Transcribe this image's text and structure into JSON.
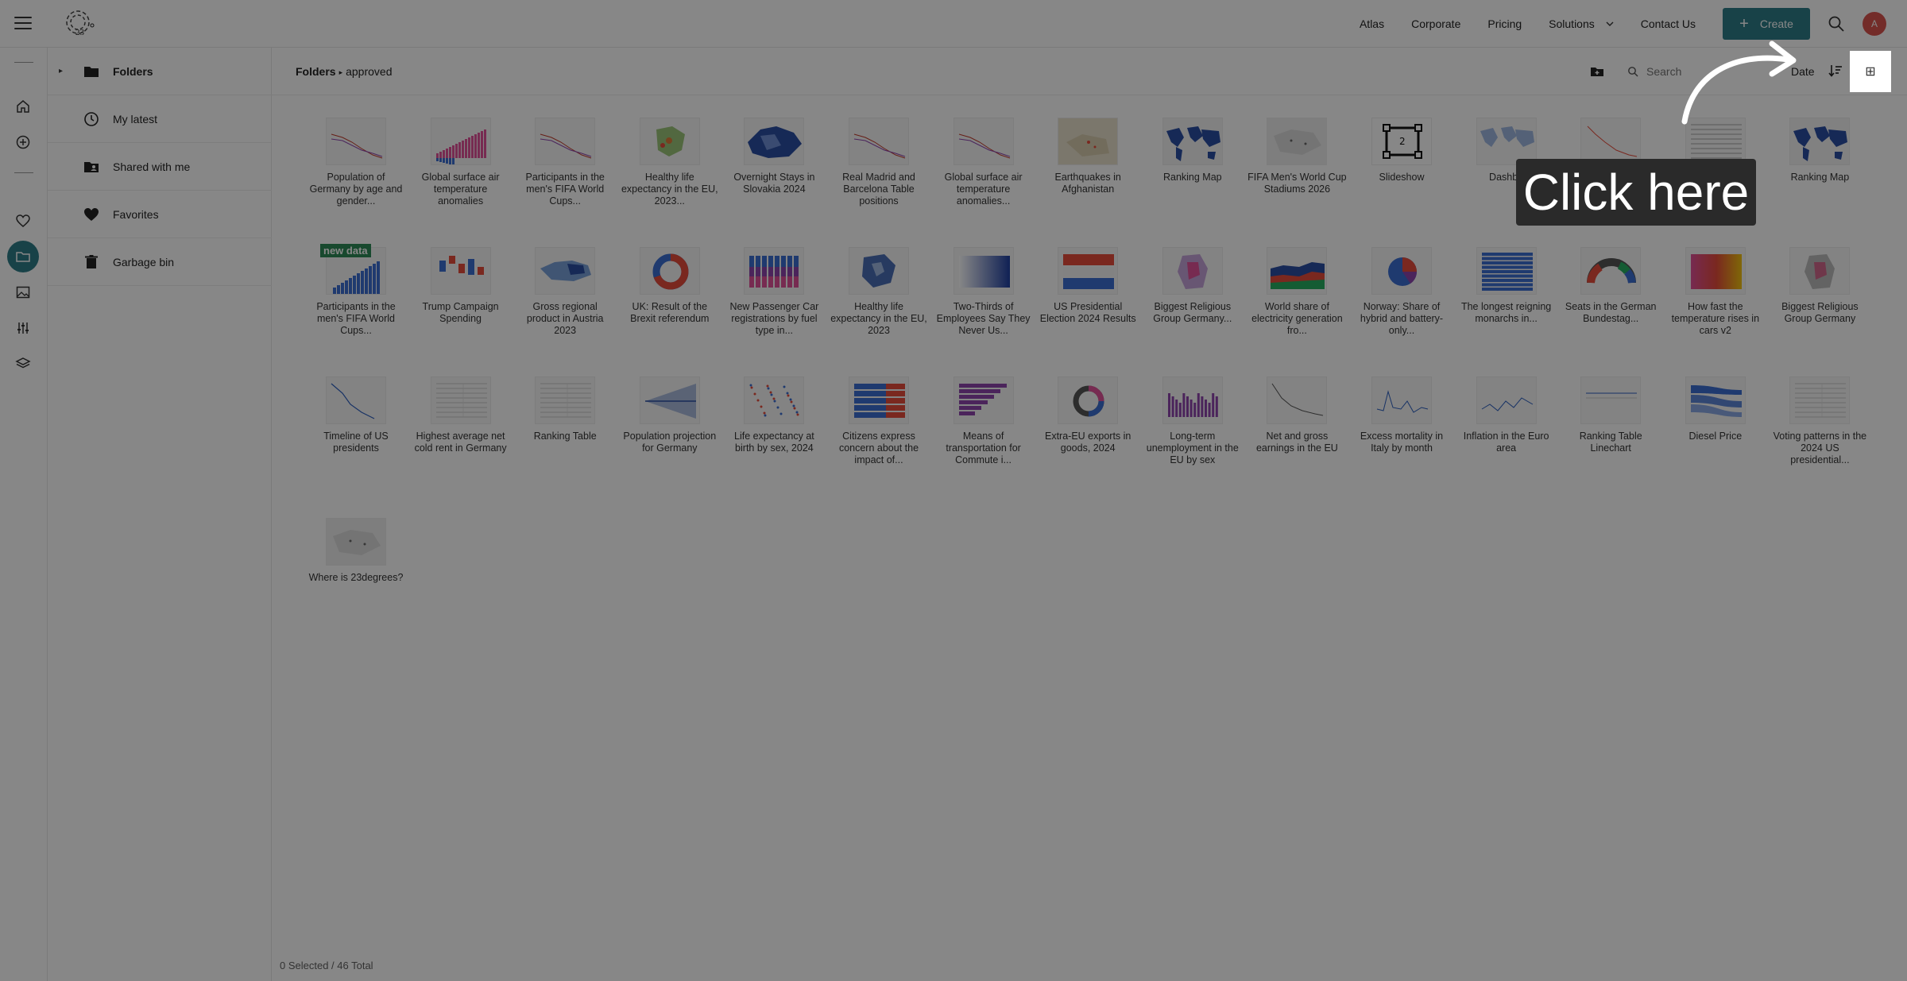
{
  "topnav": {
    "links": [
      "Atlas",
      "Corporate",
      "Pricing",
      "Solutions",
      "Contact Us"
    ],
    "create_label": "Create",
    "avatar_initial": "A",
    "accent_color": "#2e7d88"
  },
  "rail": {
    "icons": [
      "home-icon",
      "add-circle-icon",
      "heart-icon",
      "folder-icon",
      "image-icon",
      "sliders-icon",
      "layers-icon"
    ],
    "active": "folder-icon"
  },
  "panel": {
    "items": [
      {
        "label": "Folders",
        "icon": "folder-icon"
      },
      {
        "label": "My latest",
        "icon": "clock-icon"
      },
      {
        "label": "Shared with me",
        "icon": "shared-folder-icon"
      },
      {
        "label": "Favorites",
        "icon": "heart-icon"
      },
      {
        "label": "Garbage bin",
        "icon": "trash-icon"
      }
    ]
  },
  "content": {
    "breadcrumb_root": "Folders",
    "breadcrumb_sep": "▸",
    "breadcrumb_current": "approved",
    "search_placeholder": "Search",
    "sort_label": "Date",
    "grid_icon": "⊞"
  },
  "tiles": [
    {
      "label": "Population of Germany by age and gender...",
      "kind": "line"
    },
    {
      "label": "Global surface air temperature anomalies",
      "kind": "bars-warm"
    },
    {
      "label": "Participants in the men's FIFA World Cups...",
      "kind": "line"
    },
    {
      "label": "Healthy life expectancy in the EU, 2023...",
      "kind": "map-eu"
    },
    {
      "label": "Overnight Stays in Slovakia 2024",
      "kind": "map-blue"
    },
    {
      "label": "Real Madrid and Barcelona Table positions",
      "kind": "line"
    },
    {
      "label": "Global surface air temperature anomalies...",
      "kind": "line"
    },
    {
      "label": "Earthquakes in Afghanistan",
      "kind": "map-beige"
    },
    {
      "label": "Ranking Map",
      "kind": "world-blue"
    },
    {
      "label": "FIFA Men's World Cup Stadiums 2026",
      "kind": "map-plain"
    },
    {
      "label": "Slideshow",
      "kind": "slideshow"
    },
    {
      "label": "Dashbo",
      "kind": "world-light"
    },
    {
      "label": "",
      "kind": "line-red"
    },
    {
      "label": "",
      "kind": "table"
    },
    {
      "label": "Ranking Map",
      "kind": "world-blue"
    },
    {
      "label": "Participants in the men's FIFA World Cups...",
      "kind": "bars-blue",
      "badge": "new data"
    },
    {
      "label": "Trump Campaign Spending",
      "kind": "waterfall"
    },
    {
      "label": "Gross regional product in Austria 2023",
      "kind": "map-blue-light"
    },
    {
      "label": "UK: Result of the Brexit referendum",
      "kind": "donut-red"
    },
    {
      "label": "New Passenger Car registrations by fuel type in...",
      "kind": "stacked-bars"
    },
    {
      "label": "Healthy life expectancy in the EU, 2023",
      "kind": "map-eu-blue"
    },
    {
      "label": "Two-Thirds of Employees Say They Never Us...",
      "kind": "gradient-blue"
    },
    {
      "label": "US Presidential Election 2024 Results",
      "kind": "flag-bars"
    },
    {
      "label": "Biggest Religious Group Germany...",
      "kind": "map-purple"
    },
    {
      "label": "World share of electricity generation fro...",
      "kind": "area"
    },
    {
      "label": "Norway: Share of hybrid and battery-only...",
      "kind": "pie"
    },
    {
      "label": "The longest reigning monarchs in...",
      "kind": "hbars-blue"
    },
    {
      "label": "Seats in the German Bundestag...",
      "kind": "parliament"
    },
    {
      "label": "How fast the temperature rises in cars v2",
      "kind": "heatmap"
    },
    {
      "label": "Biggest Religious Group Germany",
      "kind": "map-grey"
    },
    {
      "label": "Timeline of US presidents",
      "kind": "line-blue"
    },
    {
      "label": "Highest average net cold rent in Germany",
      "kind": "table-light"
    },
    {
      "label": "Ranking Table",
      "kind": "table-light"
    },
    {
      "label": "Population projection for Germany",
      "kind": "fan"
    },
    {
      "label": "Life expectancy at birth by sex, 2024",
      "kind": "dots"
    },
    {
      "label": "Citizens express concern about the impact of...",
      "kind": "hbars-stacked"
    },
    {
      "label": "Means of transportation for Commute i...",
      "kind": "hbars-purple"
    },
    {
      "label": "Extra-EU exports in goods, 2024",
      "kind": "donut-multi"
    },
    {
      "label": "Long-term unemployment in the EU by sex",
      "kind": "columns-purple"
    },
    {
      "label": "Net and gross earnings in the EU",
      "kind": "line-fall"
    },
    {
      "label": "Excess mortality in Italy by month",
      "kind": "line-spiky"
    },
    {
      "label": "Inflation in the Euro area",
      "kind": "line-wavy"
    },
    {
      "label": "Ranking Table Linechart",
      "kind": "line-flat"
    },
    {
      "label": "Diesel Price",
      "kind": "sankey"
    },
    {
      "label": "Voting patterns in the 2024 US presidential...",
      "kind": "table-light"
    },
    {
      "label": "Where is 23degrees?",
      "kind": "map-plain"
    }
  ],
  "footer": {
    "status": "0 Selected / 46 Total"
  },
  "callout": {
    "text": "Click here"
  }
}
